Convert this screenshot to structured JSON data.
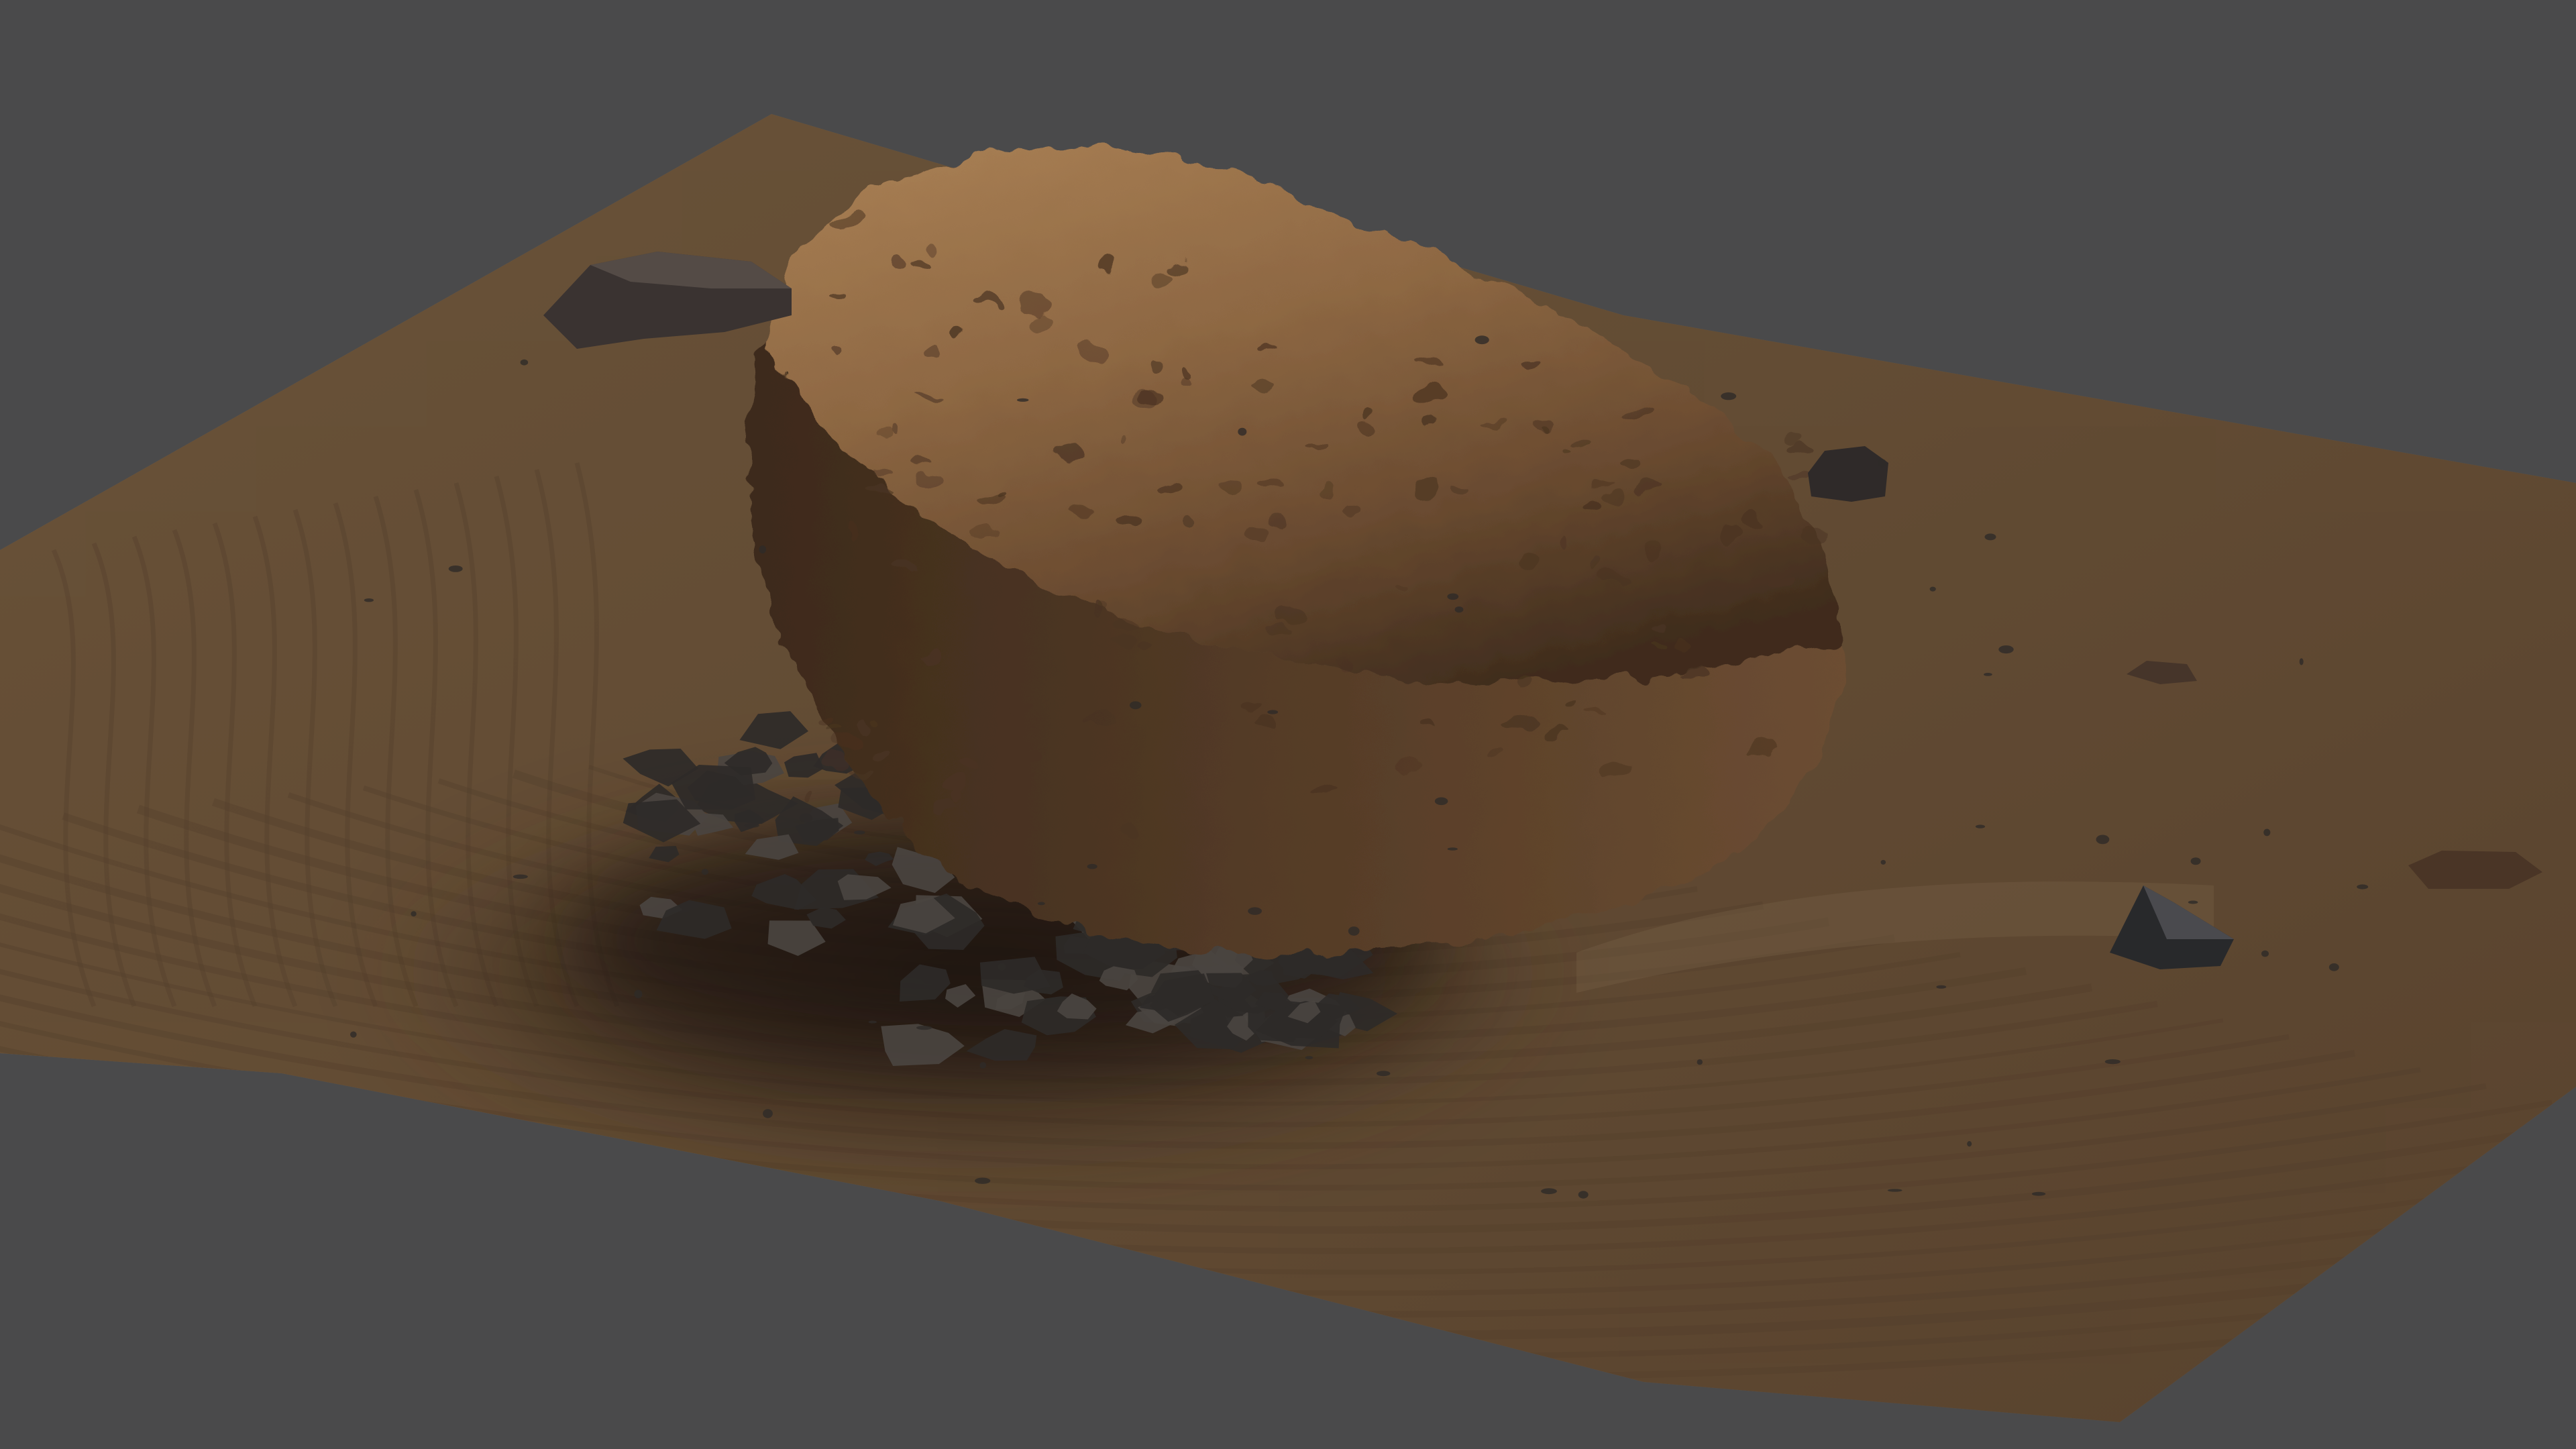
{
  "viewport": {
    "background_color": "#4a4a4b",
    "description_free": true
  },
  "terrain": {
    "type": "sand-terrain-patch",
    "base_color": "#a9835c",
    "light_color": "#c49d74",
    "shadow_color": "#3b2c1f",
    "ripple_color": "#8a6848"
  },
  "boulder": {
    "type": "large-porous-boulder",
    "lit_color": "#a1784f",
    "mid_color": "#7d5a3b",
    "dark_color": "#3c2a1c",
    "pit_color": "#4a3322"
  },
  "rocks": {
    "type": "dark-small-rocks",
    "color": "#2e2a28",
    "highlight_color": "#4a4440"
  }
}
